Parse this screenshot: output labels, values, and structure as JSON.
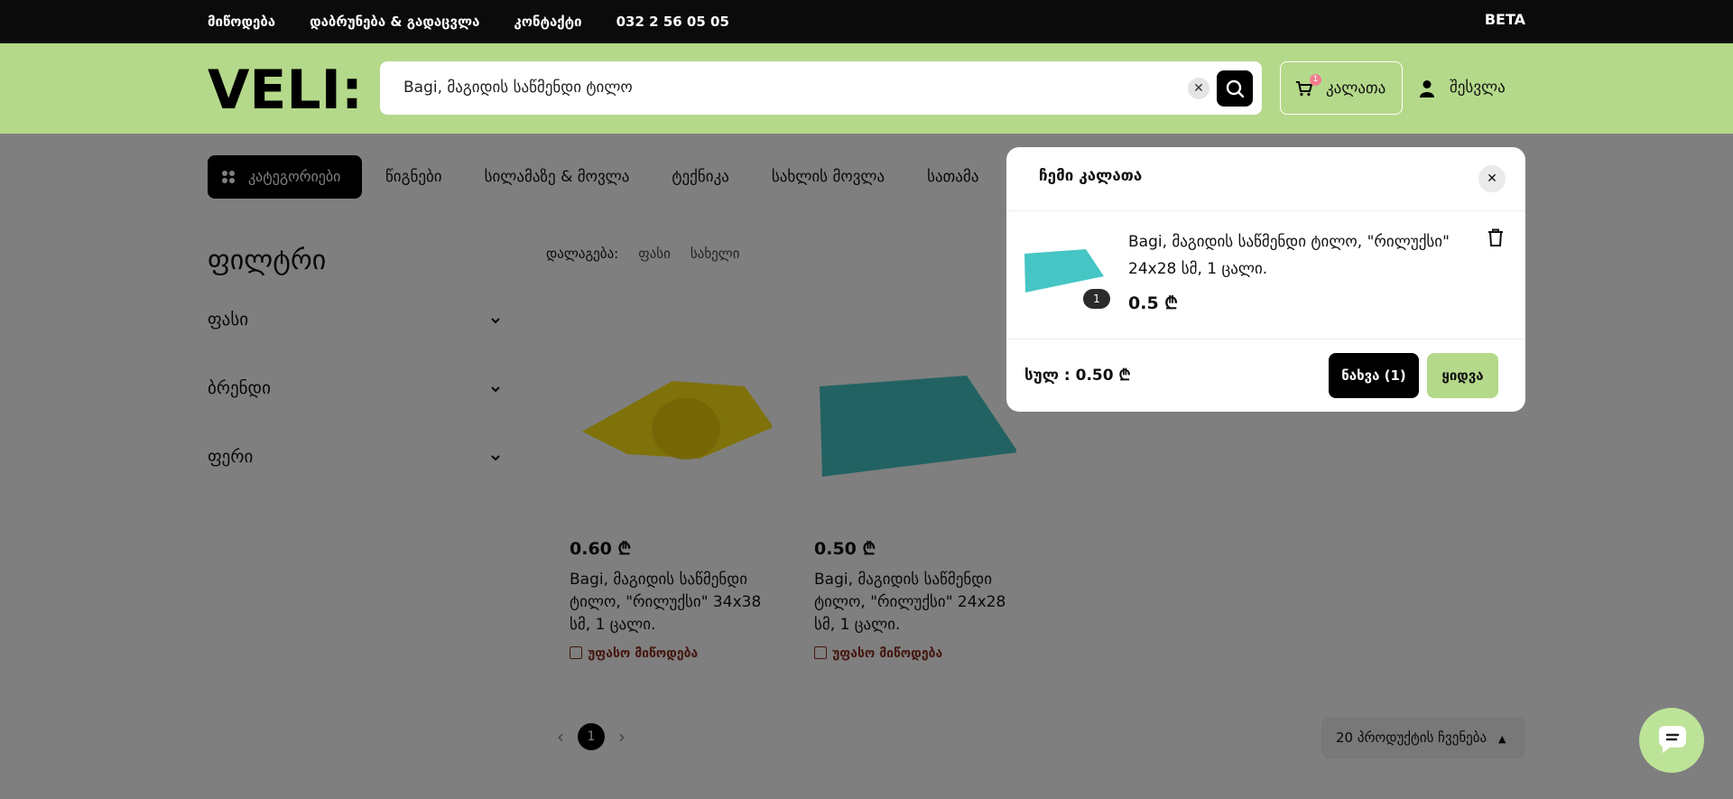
{
  "topbar": {
    "links": [
      "მიწოდება",
      "დაბრუნება & გადაცვლა",
      "კონტაქტი",
      "032 2 56 05 05"
    ],
    "beta": "BETA"
  },
  "header": {
    "logo_text": "VELI:",
    "search_value": "Bagi, მაგიდის საწმენდი ტილო",
    "cart_label": "კალათა",
    "cart_count": "1",
    "login_label": "შესვლა"
  },
  "nav": {
    "categories_label": "კატეგორიები",
    "links": [
      "წიგნები",
      "სილამაზე & მოვლა",
      "ტექნიკა",
      "სახლის მოვლა",
      "სათამა"
    ]
  },
  "filters": {
    "title": "ფილტრი",
    "items": [
      "ფასი",
      "ბრენდი",
      "ფერი"
    ]
  },
  "sort": {
    "label": "დალაგება:",
    "options": [
      "ფასი",
      "სახელი"
    ]
  },
  "products": [
    {
      "price": "0.60 ₾",
      "name": "Bagi, მაგიდის საწმენდი ტილო, \"რილუქსი\" 34x38 სმ, 1 ცალი.",
      "shipping": "უფასო მიწოდება"
    },
    {
      "price": "0.50 ₾",
      "name": "Bagi, მაგიდის საწმენდი ტილო, \"რილუქსი\" 24x28 სმ, 1 ცალი.",
      "shipping": "უფასო მიწოდება"
    }
  ],
  "pagination": {
    "current": "1"
  },
  "per_page": "20 პროდუქტის ჩვენება",
  "cart_popup": {
    "title": "ჩემი კალათა",
    "item_name": "Bagi, მაგიდის საწმენდი ტილო, \"რილუქსი\" 24x28 სმ, 1 ცალი.",
    "item_qty": "1",
    "item_price": "0.5 ₾",
    "total": "სულ : 0.50 ₾",
    "view_label": "ნახვა (1)",
    "buy_label": "ყიდვა"
  },
  "colors": {
    "accent_green": "#b4d98a",
    "dark": "#0b0b0b",
    "ship_text": "#8b2f1f"
  }
}
